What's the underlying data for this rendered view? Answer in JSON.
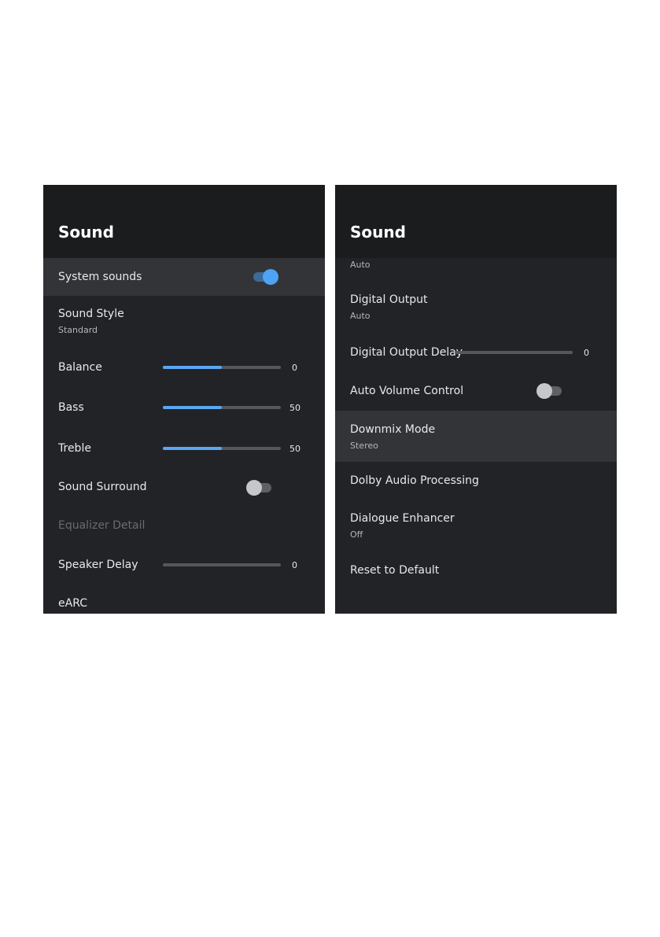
{
  "left_panel": {
    "title": "Sound",
    "system_sounds": {
      "label": "System sounds",
      "toggle_on": true
    },
    "sound_style": {
      "label": "Sound Style",
      "value": "Standard"
    },
    "balance": {
      "label": "Balance",
      "value": "0",
      "level": 0.5
    },
    "bass": {
      "label": "Bass",
      "value": "50",
      "level": 0.5
    },
    "treble": {
      "label": "Treble",
      "value": "50",
      "level": 0.5
    },
    "sound_surround": {
      "label": "Sound Surround",
      "toggle_on": false
    },
    "equalizer_detail": {
      "label": "Equalizer Detail",
      "disabled": true
    },
    "speaker_delay": {
      "label": "Speaker Delay",
      "value": "0",
      "level": 0
    },
    "earc": {
      "label": "eARC"
    }
  },
  "right_panel": {
    "title": "Sound",
    "top_value": "Auto",
    "digital_output": {
      "label": "Digital Output",
      "value": "Auto"
    },
    "digital_output_delay": {
      "label": "Digital Output Delay",
      "value": "0",
      "level": 0
    },
    "auto_volume_control": {
      "label": "Auto Volume Control",
      "toggle_on": false
    },
    "downmix_mode": {
      "label": "Downmix Mode",
      "value": "Stereo"
    },
    "dolby_audio_processing": {
      "label": "Dolby Audio Processing"
    },
    "dialogue_enhancer": {
      "label": "Dialogue Enhancer",
      "value": "Off"
    },
    "reset_to_default": {
      "label": "Reset to Default"
    }
  },
  "colors": {
    "panel_bg": "#222326",
    "header_bg": "#1b1c1e",
    "highlight_bg": "#333437",
    "accent": "#5aa6f2",
    "disabled_text": "#6a6b6e"
  }
}
